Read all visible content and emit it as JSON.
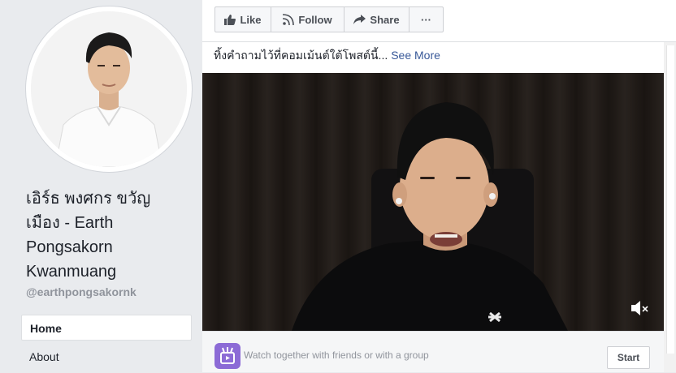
{
  "sidebar": {
    "page_name": "เอิร์ธ พงศกร ขวัญ\nเมือง - Earth\nPongsakorn\nKwanmuang",
    "handle": "@earthpongsakornk",
    "nav": [
      {
        "label": "Home",
        "active": true
      },
      {
        "label": "About",
        "active": false
      }
    ]
  },
  "actions": {
    "like_label": "Like",
    "follow_label": "Follow",
    "share_label": "Share",
    "more_label": "···"
  },
  "post": {
    "text": "ทิ้งคำถามไว้ที่คอมเม้นต์ใต้โพสต์นี้...",
    "see_more": "See More"
  },
  "watch_together": {
    "text": "Watch together with friends or with a group",
    "start_label": "Start"
  },
  "icons": {
    "like": "thumbs-up-icon",
    "follow": "rss-icon",
    "share": "share-arrow-icon",
    "mute": "volume-muted-icon",
    "watch": "watch-party-icon"
  },
  "colors": {
    "link": "#385898",
    "accent_purple": "#8c6bd6",
    "page_bg": "#e9ebee"
  }
}
